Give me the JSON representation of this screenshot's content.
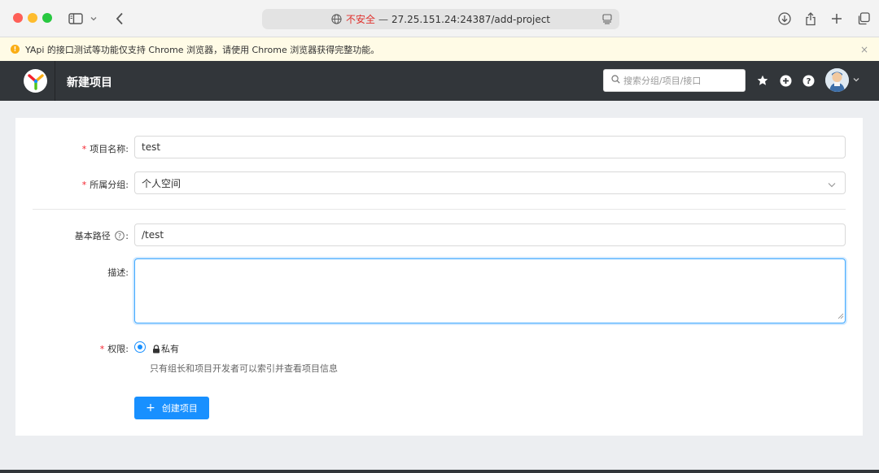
{
  "browser": {
    "insecure_label": "不安全",
    "separator": "—",
    "url": "27.25.151.24:24387/add-project"
  },
  "notice": {
    "text": "YApi 的接口测试等功能仅支持 Chrome 浏览器，请使用 Chrome 浏览器获得完整功能。",
    "close": "×"
  },
  "header": {
    "title": "新建项目",
    "search_placeholder": "搜索分组/项目/接口"
  },
  "form": {
    "name_label": "项目名称",
    "name_value": "test",
    "group_label": "所属分组",
    "group_value": "个人空间",
    "basepath_label": "基本路径",
    "basepath_value": "/test",
    "desc_label": "描述",
    "desc_value": "",
    "perm_label": "权限",
    "perm_option": "私有",
    "perm_help": "只有组长和项目开发者可以索引并查看项目信息",
    "required_mark": "*",
    "colon": ":",
    "submit_label": "创建项目"
  },
  "colors": {
    "primary": "#1890ff",
    "header_bg": "#32363a",
    "notice_bg": "#fffbe6",
    "warn": "#faad14",
    "required": "#f5222d"
  }
}
